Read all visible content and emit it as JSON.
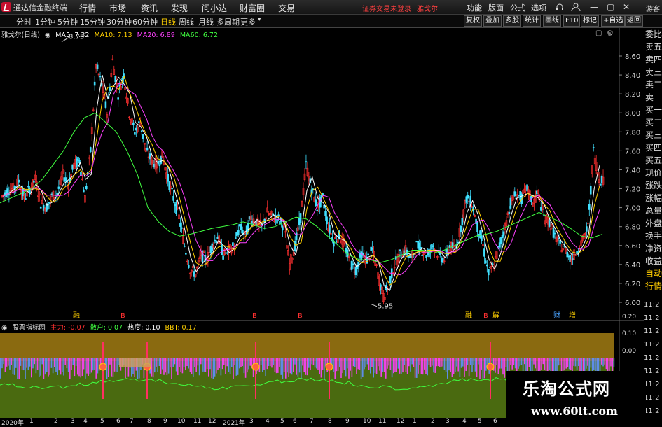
{
  "menubar": {
    "app_name": "通达信金融终端",
    "items": [
      "行情",
      "市场",
      "资讯",
      "发现",
      "问小达",
      "财富圈",
      "交易"
    ],
    "notice": "证券交易未登录",
    "stock": "雅戈尔",
    "right_items": [
      "功能",
      "版面",
      "公式",
      "选项"
    ],
    "guest": "游客"
  },
  "toolbar": {
    "periods": [
      "分时",
      "1分钟",
      "5分钟",
      "15分钟",
      "30分钟",
      "60分钟",
      "日线",
      "周线",
      "月线",
      "多周期",
      "更多"
    ],
    "active": "日线",
    "right_buttons": [
      "复权",
      "叠加",
      "多股",
      "统计",
      "画线",
      "F10",
      "标记",
      "+自选",
      "返回"
    ]
  },
  "legend": {
    "title": "雅戈尔(日线)",
    "ma5": "MA5: 7.32",
    "ma10": "MA10: 7.13",
    "ma20": "MA20: 6.89",
    "ma60": "MA60: 6.72"
  },
  "annotations": {
    "high": "8.75",
    "low": "5.95"
  },
  "markers": [
    {
      "text": "融",
      "color": "#ffd000"
    },
    {
      "text": "B",
      "color": "#ff3030"
    },
    {
      "text": "B",
      "color": "#ff3030"
    },
    {
      "text": "B",
      "color": "#ff3030"
    },
    {
      "text": "融",
      "color": "#ffd000"
    },
    {
      "text": "B",
      "color": "#ff3030"
    },
    {
      "text": "解",
      "color": "#ffd000"
    },
    {
      "text": "财",
      "color": "#4aa3ff"
    },
    {
      "text": "增",
      "color": "#ffd000"
    }
  ],
  "right_panel": {
    "items": [
      "委比",
      "卖五",
      "卖四",
      "卖三",
      "卖二",
      "卖一",
      "买一",
      "买二",
      "买三",
      "买四",
      "买五",
      "现价",
      "涨跌",
      "涨幅",
      "总量",
      "外盘",
      "换手",
      "净资",
      "收益",
      "自动",
      "行情"
    ],
    "times": [
      "11:2",
      "11:2",
      "11:2",
      "11:2",
      "11:2",
      "11:2",
      "11:2",
      "11:2",
      "11:2"
    ]
  },
  "sub_legend": {
    "title": "股票指标网",
    "l1": "主力: -0.07",
    "l2": "散户: 0.07",
    "l3": "热度: 0.10",
    "l4": "BBT: 0.17"
  },
  "sub_ticks": [
    "0.20",
    "0.10",
    "0.00"
  ],
  "xaxis": [
    "2020年",
    "1",
    "2",
    "3",
    "4",
    "5",
    "6",
    "7",
    "8",
    "9",
    "10",
    "11",
    "12",
    "2021年",
    "3",
    "4",
    "5",
    "6",
    "7",
    "8",
    "9",
    "10",
    "11",
    "12",
    "1",
    "2",
    "3",
    "4",
    "5",
    "6",
    "7"
  ],
  "watermark": {
    "line1": "乐淘公式网",
    "line2": "www.60lt.com"
  },
  "chart_data": {
    "type": "line",
    "title": "雅戈尔(日线)",
    "y_ticks": [
      "8.60",
      "8.40",
      "8.20",
      "8.00",
      "7.80",
      "7.60",
      "7.40",
      "7.20",
      "7.00",
      "6.80",
      "6.60",
      "6.40",
      "6.20",
      "6.00"
    ],
    "ylim": [
      5.9,
      8.8
    ],
    "series": [
      {
        "name": "MA5",
        "color": "#ffffff"
      },
      {
        "name": "MA10",
        "color": "#ffd000"
      },
      {
        "name": "MA20",
        "color": "#ff40ff"
      },
      {
        "name": "MA60",
        "color": "#40ff40"
      }
    ],
    "close_path": [
      7.12,
      7.18,
      7.2,
      7.28,
      7.1,
      7.2,
      7.3,
      7.05,
      7.0,
      7.12,
      7.15,
      7.35,
      7.25,
      7.45,
      7.5,
      7.1,
      7.6,
      8.5,
      8.3,
      8.0,
      8.55,
      8.2,
      8.4,
      8.0,
      7.8,
      7.9,
      7.6,
      7.5,
      7.45,
      7.55,
      7.3,
      7.1,
      6.9,
      6.6,
      6.35,
      6.3,
      6.5,
      6.45,
      6.6,
      6.7,
      6.5,
      6.55,
      6.6,
      6.8,
      6.7,
      6.9,
      6.85,
      6.8,
      6.95,
      6.9,
      6.88,
      6.8,
      6.4,
      6.6,
      6.9,
      7.45,
      7.2,
      7.0,
      7.1,
      6.8,
      6.65,
      6.7,
      6.6,
      6.4,
      6.35,
      6.5,
      6.45,
      6.55,
      6.3,
      6.05,
      6.2,
      6.4,
      6.5,
      6.55,
      6.45,
      6.6,
      6.55,
      6.5,
      6.6,
      6.5,
      6.45,
      6.6,
      6.55,
      6.8,
      7.1,
      7.05,
      6.8,
      6.6,
      6.3,
      6.4,
      6.6,
      6.8,
      7.05,
      7.15,
      7.1,
      7.2,
      7.05,
      7.15,
      6.9,
      6.85,
      6.7,
      6.6,
      6.55,
      6.45,
      6.55,
      6.65,
      6.8,
      7.6,
      7.3
    ],
    "ma60_path": [
      7.05,
      7.1,
      7.15,
      7.2,
      7.3,
      7.45,
      7.6,
      7.8,
      7.95,
      8.0,
      7.9,
      7.8,
      7.6,
      7.35,
      7.0,
      6.85,
      6.75,
      6.7,
      6.72,
      6.75,
      6.78,
      6.8,
      6.82,
      6.85,
      6.82,
      6.78,
      6.8,
      6.85,
      6.9,
      6.88,
      6.8,
      6.7,
      6.6,
      6.5,
      6.45,
      6.45,
      6.42,
      6.45,
      6.5,
      6.55,
      6.55,
      6.52,
      6.55,
      6.6,
      6.65,
      6.7,
      6.72,
      6.75,
      6.8,
      6.85,
      6.9,
      6.95,
      6.9,
      6.85,
      6.78,
      6.7,
      6.68,
      6.72
    ],
    "sub_ylim": [
      -0.15,
      0.25
    ]
  }
}
